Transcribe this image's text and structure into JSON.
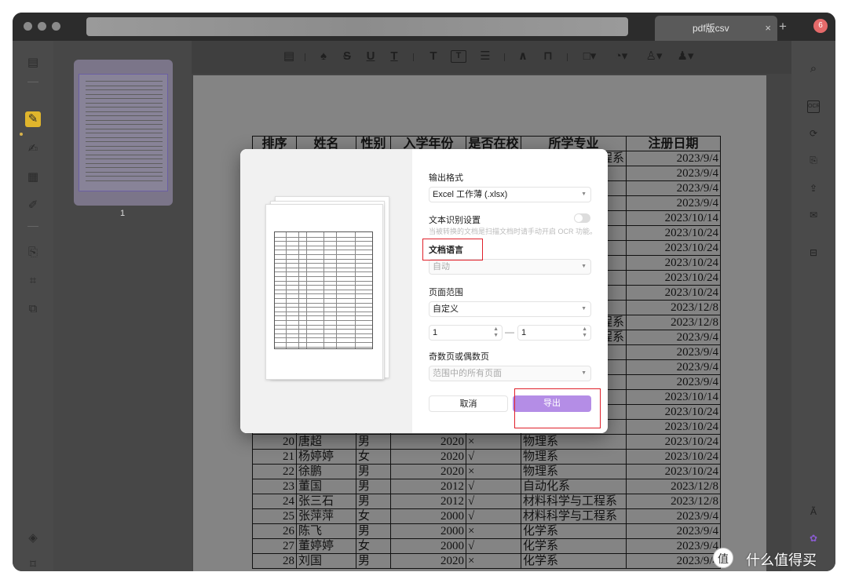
{
  "window": {
    "tab_title": "pdf版csv",
    "tab_close": "×",
    "tab_plus": "+",
    "avatar": "6"
  },
  "toolbar": {
    "tools": [
      "comment-icon",
      "|",
      "highlight-icon",
      "S",
      "U",
      "T",
      "|",
      "T",
      "T",
      "note-icon",
      "|",
      "pen-icon",
      "eraser-icon",
      "|",
      "rect-icon",
      "shape-icon",
      "stamp-icon",
      "sign-icon"
    ]
  },
  "thumbnails": {
    "page_number": "1"
  },
  "table": {
    "headers": [
      "排序",
      "姓名",
      "性别",
      "入学年份",
      "是否在校",
      "所学专业",
      "注册日期"
    ],
    "right_dates": [
      "2023/9/4",
      "2023/9/4",
      "2023/9/4",
      "2023/9/4",
      "2023/10/14",
      "2023/10/24",
      "2023/10/24",
      "2023/10/24",
      "2023/10/24",
      "2023/10/24",
      "2023/12/8",
      "2023/12/8",
      "2023/9/4",
      "2023/9/4",
      "2023/9/4",
      "2023/9/4",
      "2023/10/14",
      "2023/10/24",
      "2023/10/24"
    ],
    "partial_major": [
      "程系",
      "",
      "",
      "",
      "",
      "",
      "",
      "",
      "",
      "",
      "",
      "程系",
      "程系"
    ],
    "rows": [
      [
        "20",
        "唐超",
        "男",
        "2020",
        "×",
        "物理系",
        "2023/10/24"
      ],
      [
        "21",
        "杨婷婷",
        "女",
        "2020",
        "√",
        "物理系",
        "2023/10/24"
      ],
      [
        "22",
        "徐鹏",
        "男",
        "2020",
        "×",
        "物理系",
        "2023/10/24"
      ],
      [
        "23",
        "董国",
        "男",
        "2012",
        "√",
        "自动化系",
        "2023/12/8"
      ],
      [
        "24",
        "张三石",
        "男",
        "2012",
        "√",
        "材料科学与工程系",
        "2023/12/8"
      ],
      [
        "25",
        "张萍萍",
        "女",
        "2000",
        "√",
        "材料科学与工程系",
        "2023/9/4"
      ],
      [
        "26",
        "陈飞",
        "男",
        "2000",
        "×",
        "化学系",
        "2023/9/4"
      ],
      [
        "27",
        "董婷婷",
        "女",
        "2000",
        "√",
        "化学系",
        "2023/9/4"
      ],
      [
        "28",
        "刘国",
        "男",
        "2020",
        "×",
        "化学系",
        "2023/9/4"
      ]
    ]
  },
  "dialog": {
    "output_format_label": "输出格式",
    "output_format_value": "Excel 工作薄 (.xlsx)",
    "ocr_label": "文本识别设置",
    "ocr_hint": "当被转换的文档是扫描文档时请手动开启 OCR 功能。",
    "language_label": "文档语言",
    "language_value": "自动",
    "page_range_label": "页面范围",
    "page_range_value": "自定义",
    "range_from": "1",
    "range_to": "1",
    "range_dash": "—",
    "odd_even_label": "奇数页或偶数页",
    "odd_even_value": "范围中的所有页面",
    "cancel": "取消",
    "export": "导出"
  },
  "watermark": {
    "text": "什么值得买",
    "logo": "值"
  },
  "colors": {
    "accent": "#b48de6",
    "highlight_box": "#e0202a",
    "active_tool": "#e0b52c"
  }
}
